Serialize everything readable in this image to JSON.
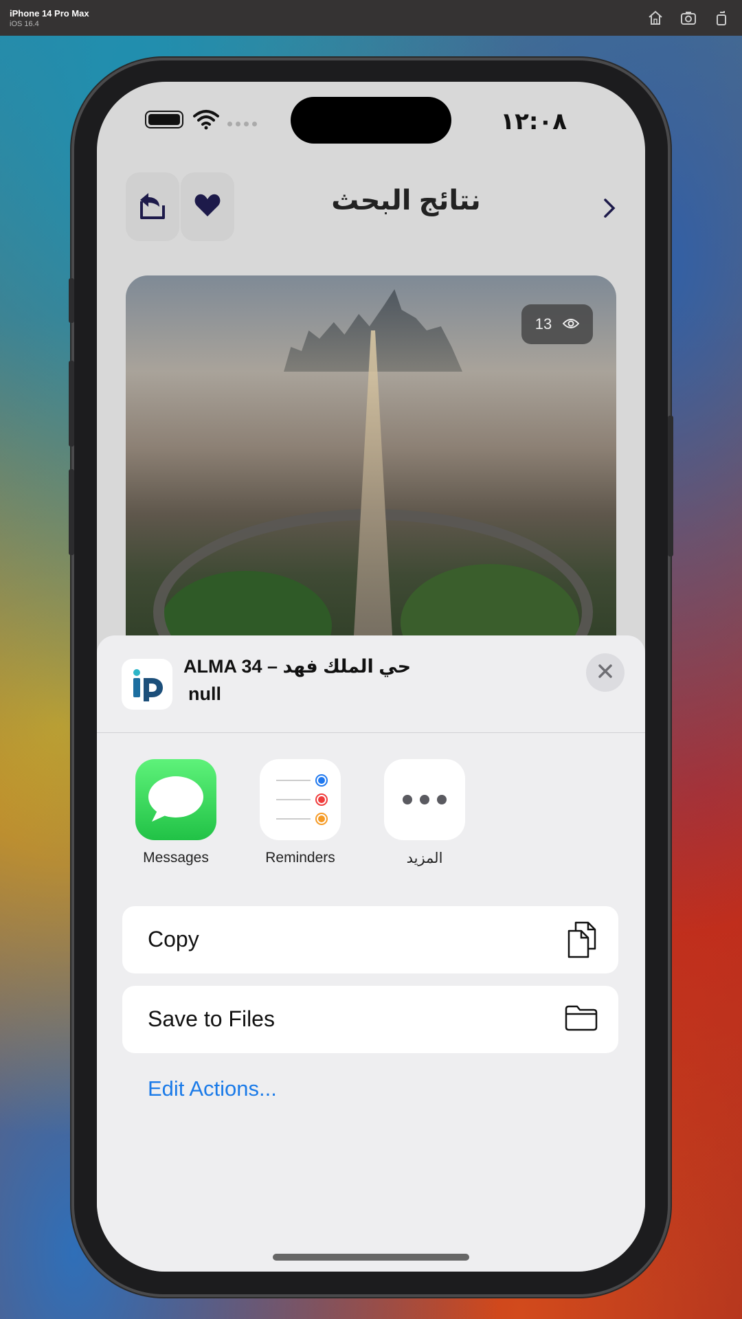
{
  "simulator": {
    "device_name": "iPhone 14 Pro Max",
    "os_version": "iOS 16.4",
    "icons": [
      "home-icon",
      "screenshot-icon",
      "rotate-icon"
    ]
  },
  "status_bar": {
    "time": "١٢:٠٨"
  },
  "header": {
    "title": "نتائج البحث",
    "icons": [
      "share-back-icon",
      "heart-icon",
      "chevron-right-icon"
    ]
  },
  "hero": {
    "view_count": "13",
    "icon": "eye-icon"
  },
  "share_sheet": {
    "title": "ALMA 34 – حي الملك فهد",
    "subtitle": "null",
    "apps": [
      {
        "label": "Messages",
        "icon": "messages-icon",
        "color": "#2fd158"
      },
      {
        "label": "Reminders",
        "icon": "reminders-icon",
        "color": "#ffffff"
      },
      {
        "label": "المزيد",
        "icon": "more-icon",
        "color": "#ffffff"
      }
    ],
    "actions": [
      {
        "label": "Copy",
        "icon": "copy-icon"
      },
      {
        "label": "Save to Files",
        "icon": "folder-icon"
      }
    ],
    "edit_actions": "Edit Actions...",
    "accent_color": "#1a7ae8"
  }
}
